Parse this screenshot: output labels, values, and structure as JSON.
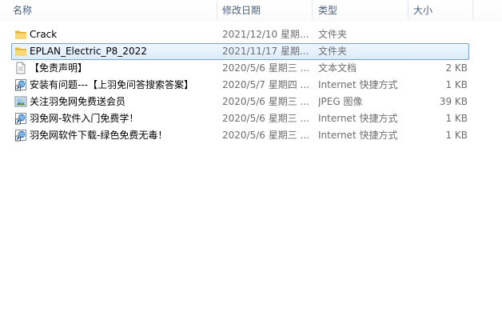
{
  "columns": {
    "name": "名称",
    "date": "修改日期",
    "type": "类型",
    "size": "大小"
  },
  "sort": {
    "column": "name",
    "direction": "ascending"
  },
  "colors": {
    "header_text": "#4c607a",
    "selection_border": "#7da2ce",
    "selection_fill": "#dcecfc",
    "secondary_text": "#6d6d6d"
  },
  "files": [
    {
      "name": "Crack",
      "date": "2021/12/10 星期...",
      "type": "文件夹",
      "size": "",
      "icon": "folder-icon",
      "selected": false
    },
    {
      "name": "EPLAN_Electric_P8_2022",
      "date": "2021/11/17 星期...",
      "type": "文件夹",
      "size": "",
      "icon": "folder-icon",
      "selected": true
    },
    {
      "name": "【免责声明】",
      "date": "2020/5/6 星期三 ...",
      "type": "文本文档",
      "size": "2 KB",
      "icon": "text-document-icon",
      "selected": false
    },
    {
      "name": "安装有问题---【上羽免问答搜索答案】",
      "date": "2020/5/7 星期四 ...",
      "type": "Internet 快捷方式",
      "size": "1 KB",
      "icon": "internet-shortcut-icon",
      "selected": false
    },
    {
      "name": "关注羽免网免费送会员",
      "date": "2020/5/6 星期三 ...",
      "type": "JPEG 图像",
      "size": "39 KB",
      "icon": "image-file-icon",
      "selected": false
    },
    {
      "name": "羽免网-软件入门免费学！",
      "date": "2020/5/6 星期三 ...",
      "type": "Internet 快捷方式",
      "size": "1 KB",
      "icon": "internet-shortcut-icon",
      "selected": false
    },
    {
      "name": "羽免网软件下载-绿色免费无毒！",
      "date": "2020/5/6 星期三 ...",
      "type": "Internet 快捷方式",
      "size": "1 KB",
      "icon": "internet-shortcut-icon",
      "selected": false
    }
  ]
}
